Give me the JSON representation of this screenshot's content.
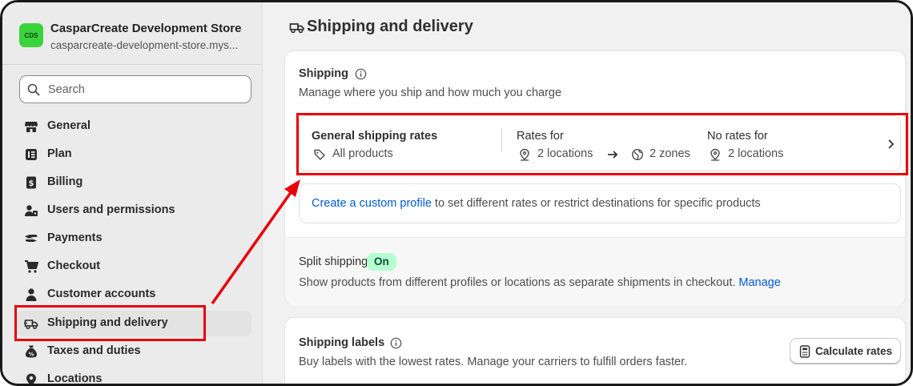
{
  "store": {
    "logo_text": "CDS",
    "name": "CasparCreate Development Store",
    "domain": "casparcreate-development-store.mys..."
  },
  "search": {
    "placeholder": "Search"
  },
  "nav": {
    "items": [
      {
        "label": "General",
        "icon": "store-icon"
      },
      {
        "label": "Plan",
        "icon": "plan-icon"
      },
      {
        "label": "Billing",
        "icon": "billing-icon"
      },
      {
        "label": "Users and permissions",
        "icon": "users-icon"
      },
      {
        "label": "Payments",
        "icon": "payments-icon"
      },
      {
        "label": "Checkout",
        "icon": "cart-icon"
      },
      {
        "label": "Customer accounts",
        "icon": "person-icon"
      },
      {
        "label": "Shipping and delivery",
        "icon": "truck-icon",
        "active": true
      },
      {
        "label": "Taxes and duties",
        "icon": "taxes-icon"
      },
      {
        "label": "Locations",
        "icon": "location-icon"
      }
    ]
  },
  "page": {
    "title": "Shipping and delivery"
  },
  "shipping": {
    "title": "Shipping",
    "subtitle": "Manage where you ship and how much you charge",
    "general_rates_title": "General shipping rates",
    "general_rates_scope": "All products",
    "rates_for_label": "Rates for",
    "rates_for_locations": "2 locations",
    "rates_for_zones": "2 zones",
    "no_rates_label": "No rates for",
    "no_rates_locations": "2 locations",
    "custom_profile_link": "Create a custom profile",
    "custom_profile_text": " to set different rates or restrict destinations for specific products",
    "split_title": "Split shipping",
    "split_badge": "On",
    "split_text": "Show products from different profiles or locations as separate shipments in checkout. ",
    "split_manage_link": "Manage"
  },
  "labels_card": {
    "title": "Shipping labels",
    "subtitle": "Buy labels with the lowest rates. Manage your carriers to fulfill orders faster.",
    "button_label": "Calculate rates"
  },
  "colors": {
    "highlight": "#e8000b",
    "link": "#005bd3",
    "badge_bg": "#b4fed2",
    "logo_bg": "#3bd33b"
  }
}
